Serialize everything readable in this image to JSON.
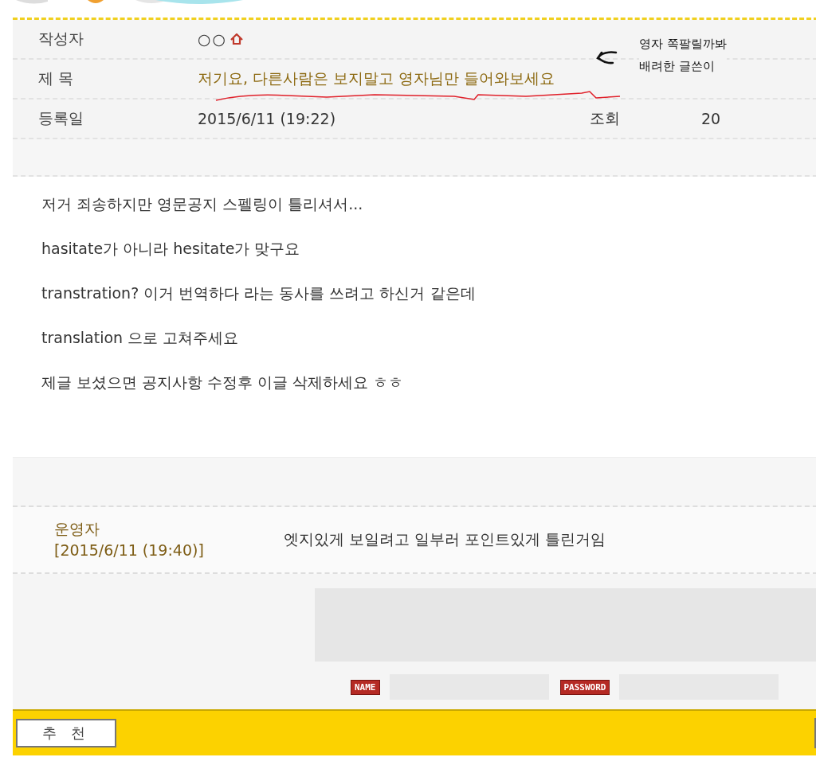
{
  "post": {
    "author_label": "작성자",
    "author": "○○",
    "title_label": "제 목",
    "title": "저기요, 다른사람은 보지말고 영자님만 들어와보세요",
    "date_label": "등록일",
    "date": "2015/6/11 (19:22)",
    "views_label": "조회",
    "views": "20"
  },
  "annotation": {
    "note_lines": [
      "영자 쪽팔릴까봐",
      "배려한 글쓴이"
    ]
  },
  "body_paragraphs": [
    "저거 죄송하지만 영문공지 스펠링이 틀리셔서...",
    "hasitate가 아니라 hesitate가 맞구요",
    "transtration? 이거 번역하다 라는 동사를 쓰려고 하신거 같은데",
    "translation 으로 고쳐주세요",
    "제글 보셨으면 공지사항 수정후 이글 삭제하세요 ㅎㅎ"
  ],
  "comments": [
    {
      "author": "운영자",
      "date": "[2015/6/11 (19:40)]",
      "text": "엣지있게 보일려고 일부러 포인트있게 틀린거임"
    }
  ],
  "comment_form": {
    "name_label": "NAME",
    "password_label": "PASSWORD"
  },
  "recommend_button": "추 천"
}
